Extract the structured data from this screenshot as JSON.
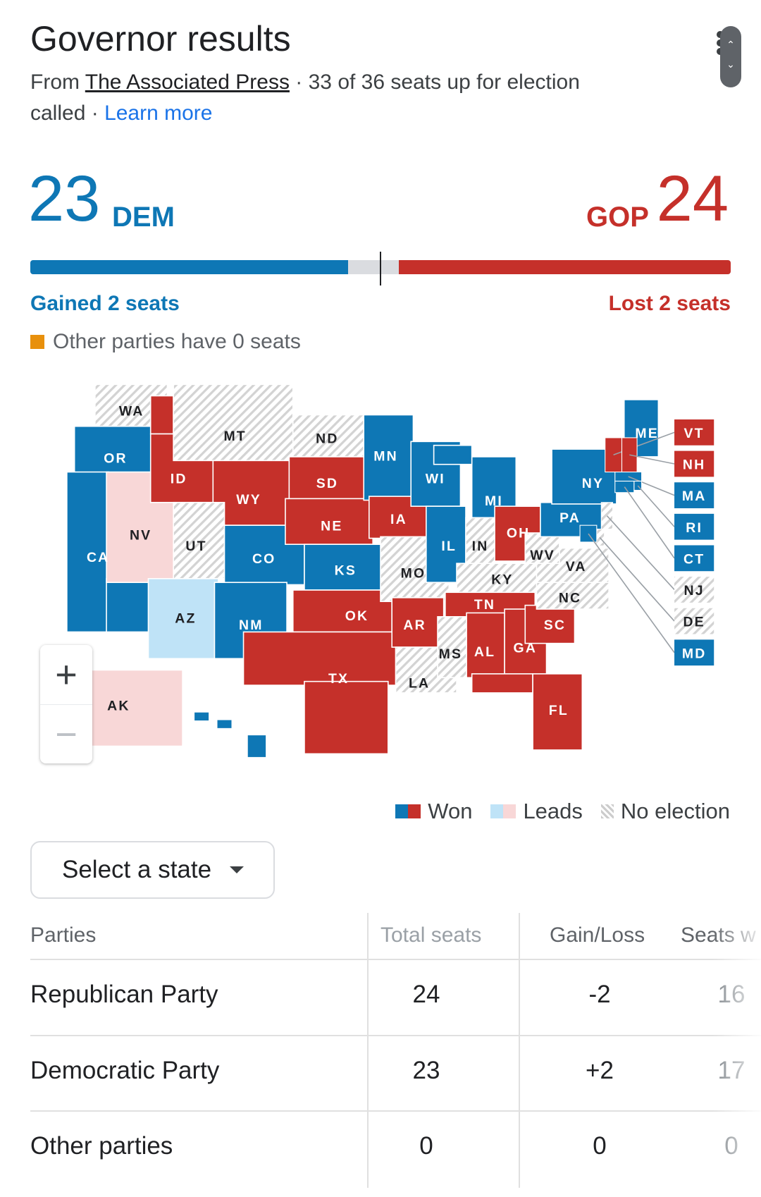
{
  "header": {
    "title": "Governor results",
    "from_label": "From",
    "source": "The Associated Press",
    "status_line1": "· 33 of 36 seats up for election",
    "status_line2": "called ·",
    "learn_more": "Learn more"
  },
  "summary": {
    "dem": {
      "count": "23",
      "label": "DEM",
      "change": "Gained 2 seats",
      "color": "#0e77b5"
    },
    "gop": {
      "count": "24",
      "label": "GOP",
      "change": "Lost 2 seats",
      "color": "#c5302a"
    },
    "other": "Other parties have 0 seats",
    "other_color": "#e8900c",
    "total_seats": 50,
    "majority_marker": 25
  },
  "map": {
    "colors": {
      "D": "#0e77b5",
      "R": "#c5302a",
      "DL": "#bfe3f7",
      "RL": "#f8d7d7",
      "N": "hatched"
    },
    "states": [
      {
        "code": "WA",
        "status": "N"
      },
      {
        "code": "OR",
        "status": "D"
      },
      {
        "code": "CA",
        "status": "D"
      },
      {
        "code": "NV",
        "status": "RL"
      },
      {
        "code": "ID",
        "status": "R"
      },
      {
        "code": "MT",
        "status": "N"
      },
      {
        "code": "WY",
        "status": "R"
      },
      {
        "code": "UT",
        "status": "N"
      },
      {
        "code": "AZ",
        "status": "DL"
      },
      {
        "code": "CO",
        "status": "D"
      },
      {
        "code": "NM",
        "status": "D"
      },
      {
        "code": "ND",
        "status": "N"
      },
      {
        "code": "SD",
        "status": "R"
      },
      {
        "code": "NE",
        "status": "R"
      },
      {
        "code": "KS",
        "status": "D"
      },
      {
        "code": "OK",
        "status": "R"
      },
      {
        "code": "TX",
        "status": "R"
      },
      {
        "code": "MN",
        "status": "D"
      },
      {
        "code": "IA",
        "status": "R"
      },
      {
        "code": "MO",
        "status": "N"
      },
      {
        "code": "AR",
        "status": "R"
      },
      {
        "code": "LA",
        "status": "N"
      },
      {
        "code": "WI",
        "status": "D"
      },
      {
        "code": "IL",
        "status": "D"
      },
      {
        "code": "MI",
        "status": "D"
      },
      {
        "code": "IN",
        "status": "N"
      },
      {
        "code": "OH",
        "status": "R"
      },
      {
        "code": "KY",
        "status": "N"
      },
      {
        "code": "TN",
        "status": "R"
      },
      {
        "code": "MS",
        "status": "N"
      },
      {
        "code": "AL",
        "status": "R"
      },
      {
        "code": "GA",
        "status": "R"
      },
      {
        "code": "FL",
        "status": "R"
      },
      {
        "code": "SC",
        "status": "R"
      },
      {
        "code": "NC",
        "status": "N"
      },
      {
        "code": "VA",
        "status": "N"
      },
      {
        "code": "WV",
        "status": "N"
      },
      {
        "code": "PA",
        "status": "D"
      },
      {
        "code": "NY",
        "status": "D"
      },
      {
        "code": "ME",
        "status": "D"
      },
      {
        "code": "AK",
        "status": "RL"
      },
      {
        "code": "HI",
        "status": "D"
      }
    ],
    "callouts": [
      {
        "code": "VT",
        "status": "R"
      },
      {
        "code": "NH",
        "status": "R"
      },
      {
        "code": "MA",
        "status": "D"
      },
      {
        "code": "RI",
        "status": "D"
      },
      {
        "code": "CT",
        "status": "D"
      },
      {
        "code": "NJ",
        "status": "N"
      },
      {
        "code": "DE",
        "status": "N"
      },
      {
        "code": "MD",
        "status": "D"
      }
    ],
    "zoom_in": "+",
    "zoom_out": "−"
  },
  "legend": {
    "won": "Won",
    "leads": "Leads",
    "no_election": "No election"
  },
  "select": {
    "label": "Select a state"
  },
  "table": {
    "headers": [
      "Parties",
      "Total seats",
      "Gain/Loss",
      "Seats w"
    ],
    "rows": [
      {
        "party": "Republican Party",
        "total": "24",
        "gain": "-2",
        "seats": "16"
      },
      {
        "party": "Democratic Party",
        "total": "23",
        "gain": "+2",
        "seats": "17"
      },
      {
        "party": "Other parties",
        "total": "0",
        "gain": "0",
        "seats": "0"
      }
    ]
  }
}
